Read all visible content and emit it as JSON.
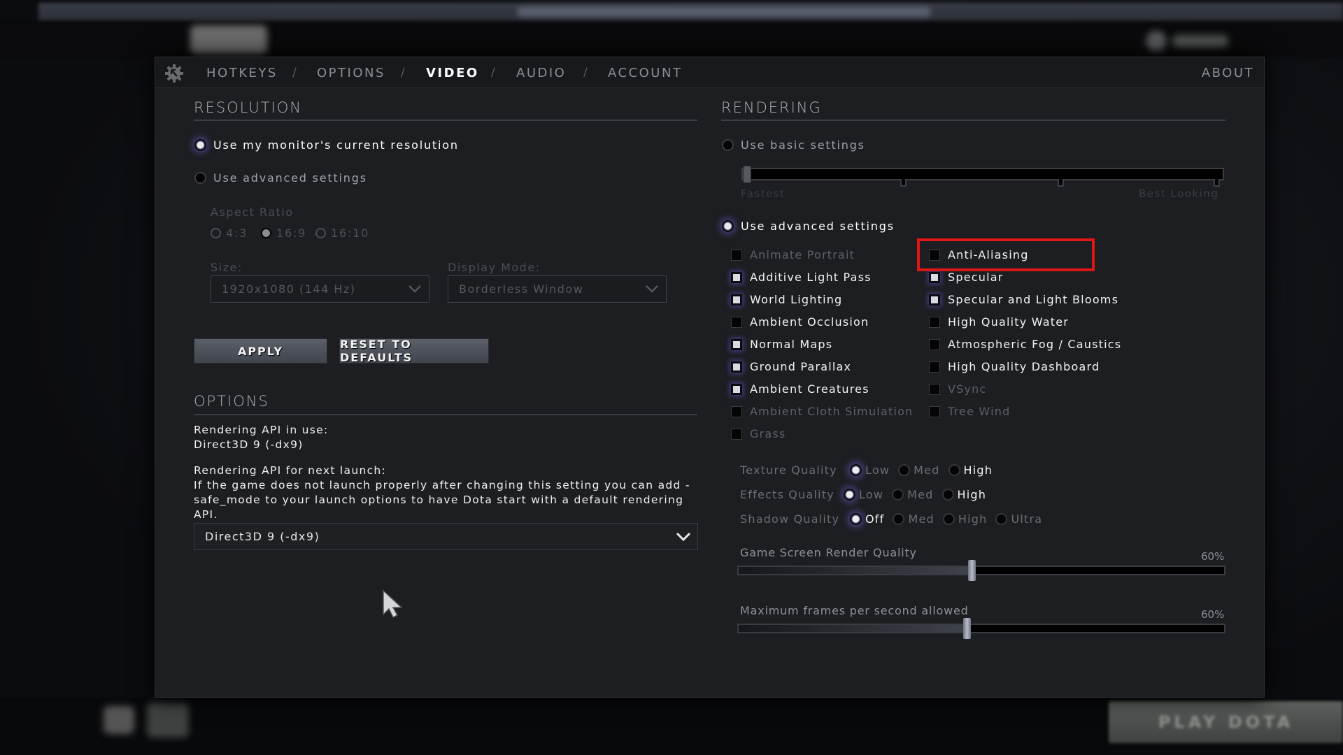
{
  "background": {
    "play_button": "PLAY DOTA"
  },
  "header": {
    "tabs": [
      {
        "label": "HOTKEYS",
        "active": false
      },
      {
        "label": "OPTIONS",
        "active": false
      },
      {
        "label": "VIDEO",
        "active": true
      },
      {
        "label": "AUDIO",
        "active": false
      },
      {
        "label": "ACCOUNT",
        "active": false
      }
    ],
    "separator": "/",
    "about": "ABOUT"
  },
  "resolution": {
    "title": "RESOLUTION",
    "use_monitor": "Use my monitor's current resolution",
    "use_advanced": "Use advanced settings",
    "selected": "use_monitor",
    "aspect_ratio_label": "Aspect Ratio",
    "aspect_ratios": [
      {
        "label": "4:3",
        "selected": false
      },
      {
        "label": "16:9",
        "selected": true
      },
      {
        "label": "16:10",
        "selected": false
      }
    ],
    "size_label": "Size:",
    "size_value": "1920x1080 (144 Hz)",
    "display_mode_label": "Display Mode:",
    "display_mode_value": "Borderless Window",
    "apply": "APPLY",
    "reset": "RESET TO DEFAULTS"
  },
  "options": {
    "title": "OPTIONS",
    "api_in_use_label": "Rendering API in use:",
    "api_in_use_value": "Direct3D 9 (-dx9)",
    "api_next_label": "Rendering API for next launch:",
    "api_next_note": "If the game does not launch properly after changing this setting you can add -safe_mode to your launch options to have Dota start with a default rendering API.",
    "api_select_value": "Direct3D 9 (-dx9)"
  },
  "rendering": {
    "title": "RENDERING",
    "basic_label": "Use basic settings",
    "basic_slider_min": "Fastest",
    "basic_slider_max": "Best Looking",
    "basic_slider_position": 0,
    "advanced_label": "Use advanced settings",
    "selected": "advanced",
    "checkboxes_left": [
      {
        "label": "Animate Portrait",
        "checked": false,
        "dim": true
      },
      {
        "label": "Additive Light Pass",
        "checked": true,
        "dim": false
      },
      {
        "label": "World Lighting",
        "checked": true,
        "dim": false
      },
      {
        "label": "Ambient Occlusion",
        "checked": false,
        "dim": false
      },
      {
        "label": "Normal Maps",
        "checked": true,
        "dim": false
      },
      {
        "label": "Ground Parallax",
        "checked": true,
        "dim": false
      },
      {
        "label": "Ambient Creatures",
        "checked": true,
        "dim": false
      },
      {
        "label": "Ambient Cloth Simulation",
        "checked": false,
        "dim": true
      },
      {
        "label": "Grass",
        "checked": false,
        "dim": true
      }
    ],
    "checkboxes_right": [
      {
        "label": "Anti-Aliasing",
        "checked": false,
        "dim": false,
        "highlighted": true
      },
      {
        "label": "Specular",
        "checked": true,
        "dim": false
      },
      {
        "label": "Specular and Light Blooms",
        "checked": true,
        "dim": false
      },
      {
        "label": "High Quality Water",
        "checked": false,
        "dim": false
      },
      {
        "label": "Atmospheric Fog / Caustics",
        "checked": false,
        "dim": false
      },
      {
        "label": "High Quality Dashboard",
        "checked": false,
        "dim": false
      },
      {
        "label": "VSync",
        "checked": false,
        "dim": true
      },
      {
        "label": "Tree Wind",
        "checked": false,
        "dim": true
      }
    ],
    "quality_rows": [
      {
        "label": "Texture Quality",
        "options": [
          {
            "t": "Low",
            "on": true
          },
          {
            "t": "Med",
            "on": false
          },
          {
            "t": "High",
            "on": false,
            "bright": true
          }
        ]
      },
      {
        "label": "Effects Quality",
        "options": [
          {
            "t": "Low",
            "on": true
          },
          {
            "t": "Med",
            "on": false
          },
          {
            "t": "High",
            "on": false,
            "bright": true
          }
        ]
      },
      {
        "label": "Shadow Quality",
        "options": [
          {
            "t": "Off",
            "on": true,
            "bright": true
          },
          {
            "t": "Med",
            "on": false
          },
          {
            "t": "High",
            "on": false
          },
          {
            "t": "Ultra",
            "on": false
          }
        ]
      }
    ],
    "render_quality_label": "Game Screen Render Quality",
    "render_quality_value": "60%",
    "render_quality_fraction": 0.48,
    "max_fps_label": "Maximum frames per second allowed",
    "max_fps_value": "60%",
    "max_fps_fraction": 0.47
  },
  "colors": {
    "highlight": "#e01515",
    "accent_glow": "#6e64dc"
  }
}
